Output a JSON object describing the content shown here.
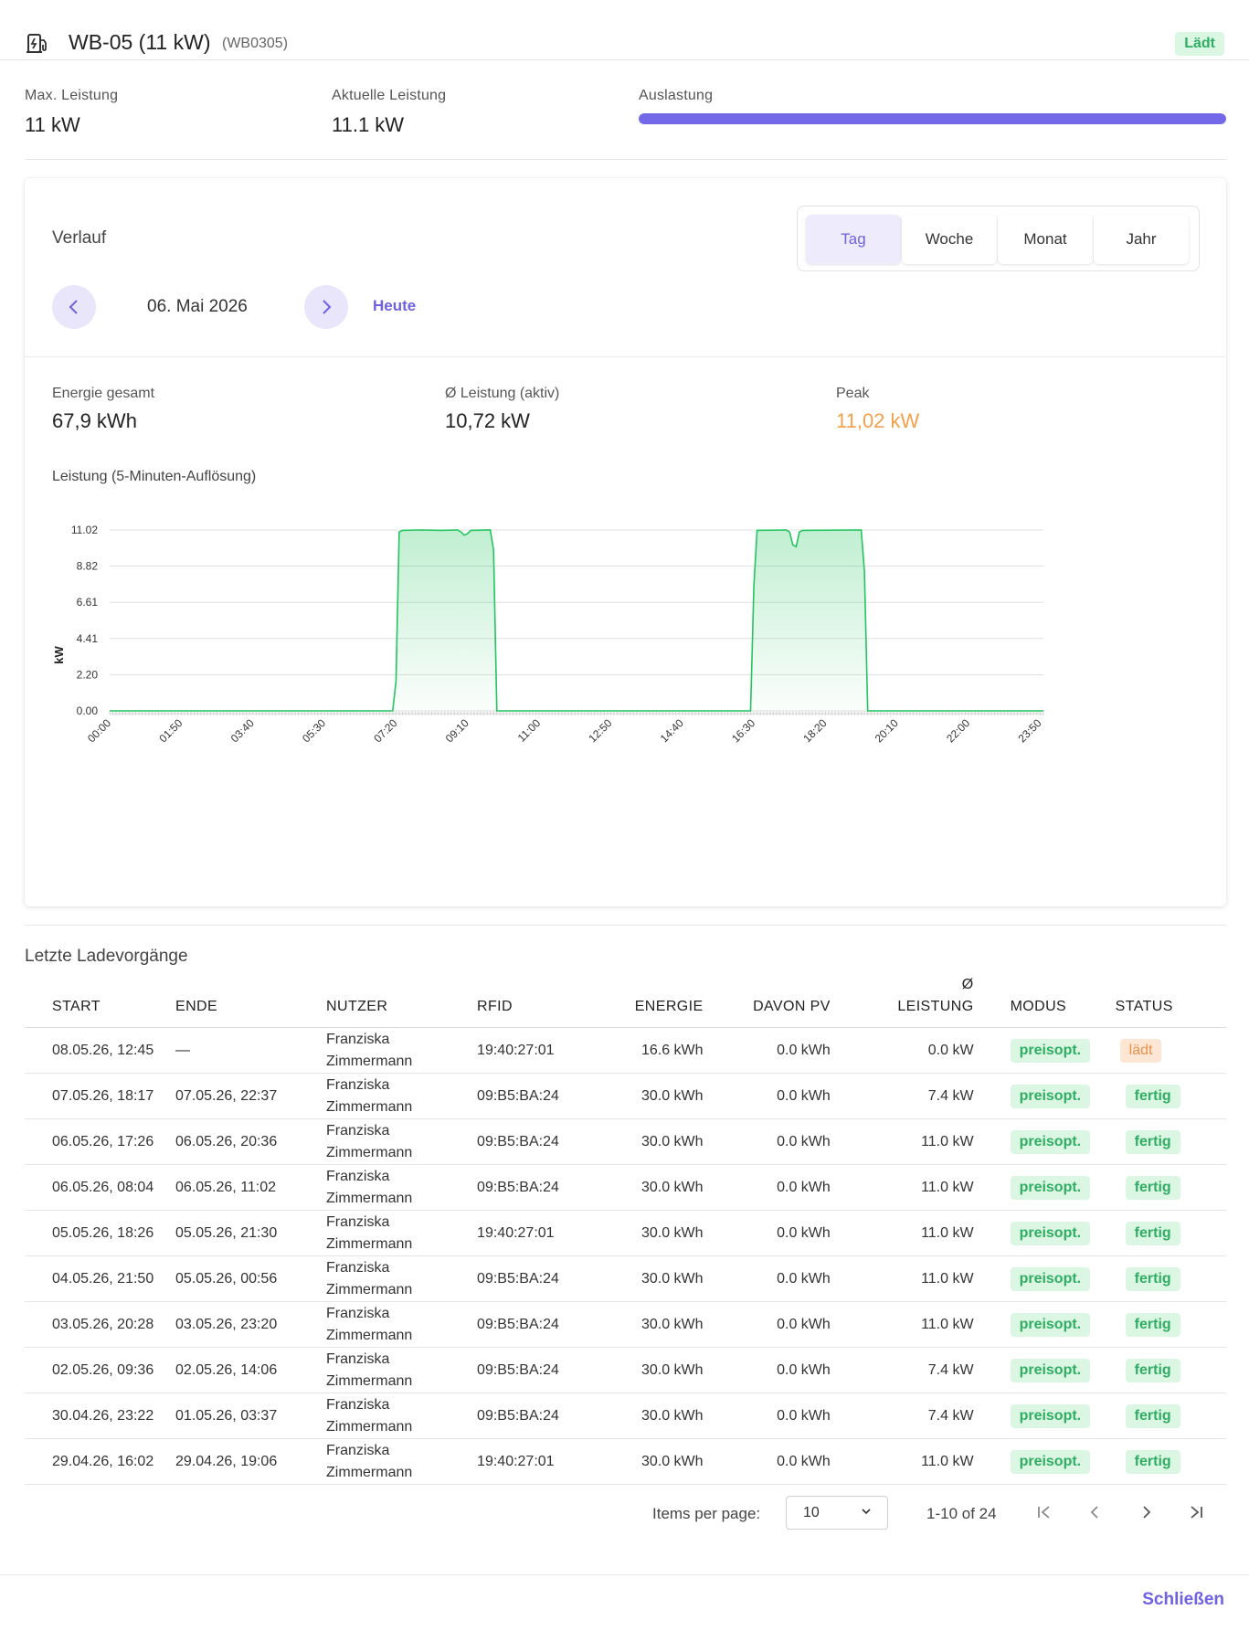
{
  "header": {
    "title": "WB-05 (11 kW)",
    "subtitle": "(WB0305)",
    "status": "Lädt"
  },
  "stats": {
    "max_label": "Max. Leistung",
    "max_value": "11 kW",
    "current_label": "Aktuelle Leistung",
    "current_value": "11.1 kW",
    "util_label": "Auslastung",
    "util_fraction": 1.0,
    "util_color": "#7268e8"
  },
  "history": {
    "title": "Verlauf",
    "tabs": [
      {
        "label": "Tag",
        "active": true
      },
      {
        "label": "Woche",
        "active": false
      },
      {
        "label": "Monat",
        "active": false
      },
      {
        "label": "Jahr",
        "active": false
      }
    ],
    "date": "06. Mai 2026",
    "today_link": "Heute",
    "prev_icon": "chevron-left-icon",
    "next_icon": "chevron-right-icon",
    "kpis": {
      "energy_label": "Energie gesamt",
      "energy_value": "67,9 kWh",
      "avg_label": "Ø Leistung (aktiv)",
      "avg_value": "10,72 kW",
      "peak_label": "Peak",
      "peak_value": "11,02 kW",
      "peak_color": "#f5a04a"
    },
    "chart_title": "Leistung (5-Minuten-Auflösung)"
  },
  "chart_data": {
    "type": "area",
    "title": "Leistung (5-Minuten-Auflösung)",
    "xlabel": "",
    "ylabel": "kW",
    "x_ticks": [
      "00:00",
      "01:50",
      "03:40",
      "05:30",
      "07:20",
      "09:10",
      "11:00",
      "12:50",
      "14:40",
      "16:30",
      "18:20",
      "20:10",
      "22:00",
      "23:50"
    ],
    "y_ticks": [
      "0.00",
      "2.20",
      "4.41",
      "6.61",
      "8.82",
      "11.02"
    ],
    "ylim": [
      0,
      11.02
    ],
    "xlim_minutes": [
      0,
      1435
    ],
    "grid": true,
    "legend": "none",
    "color": "#22c55e",
    "series": [
      {
        "points": [
          [
            "00:00",
            0
          ],
          [
            "07:15",
            0
          ],
          [
            "07:20",
            1.8
          ],
          [
            "07:25",
            10.9
          ],
          [
            "07:30",
            11.0
          ],
          [
            "08:00",
            11.02
          ],
          [
            "08:30",
            11.0
          ],
          [
            "08:55",
            11.02
          ],
          [
            "09:00",
            10.9
          ],
          [
            "09:05",
            10.7
          ],
          [
            "09:10",
            10.8
          ],
          [
            "09:15",
            11.0
          ],
          [
            "09:45",
            11.02
          ],
          [
            "09:50",
            9.8
          ],
          [
            "09:55",
            0
          ],
          [
            "16:25",
            0
          ],
          [
            "16:30",
            7.6
          ],
          [
            "16:35",
            11.0
          ],
          [
            "17:20",
            11.02
          ],
          [
            "17:25",
            10.9
          ],
          [
            "17:30",
            10.1
          ],
          [
            "17:35",
            10.0
          ],
          [
            "17:40",
            10.9
          ],
          [
            "17:45",
            11.0
          ],
          [
            "19:15",
            11.02
          ],
          [
            "19:20",
            8.5
          ],
          [
            "19:25",
            0
          ],
          [
            "23:55",
            0
          ]
        ]
      }
    ]
  },
  "recent": {
    "title": "Letzte Ladevorgänge",
    "columns": [
      "START",
      "ENDE",
      "NUTZER",
      "RFID",
      "ENERGIE",
      "DAVON PV",
      "Ø LEISTUNG",
      "MODUS",
      "STATUS"
    ],
    "rows": [
      {
        "start": "08.05.26, 12:45",
        "ende": "—",
        "nutzer": "Franziska Zimmermann",
        "rfid": "19:40:27:01",
        "energie": "16.6 kWh",
        "pv": "0.0 kWh",
        "leistung": "0.0 kW",
        "modus": "preisopt.",
        "status": "lädt",
        "status_color": "orange"
      },
      {
        "start": "07.05.26, 18:17",
        "ende": "07.05.26, 22:37",
        "nutzer": "Franziska Zimmermann",
        "rfid": "09:B5:BA:24",
        "energie": "30.0 kWh",
        "pv": "0.0 kWh",
        "leistung": "7.4 kW",
        "modus": "preisopt.",
        "status": "fertig",
        "status_color": "green"
      },
      {
        "start": "06.05.26, 17:26",
        "ende": "06.05.26, 20:36",
        "nutzer": "Franziska Zimmermann",
        "rfid": "09:B5:BA:24",
        "energie": "30.0 kWh",
        "pv": "0.0 kWh",
        "leistung": "11.0 kW",
        "modus": "preisopt.",
        "status": "fertig",
        "status_color": "green"
      },
      {
        "start": "06.05.26, 08:04",
        "ende": "06.05.26, 11:02",
        "nutzer": "Franziska Zimmermann",
        "rfid": "09:B5:BA:24",
        "energie": "30.0 kWh",
        "pv": "0.0 kWh",
        "leistung": "11.0 kW",
        "modus": "preisopt.",
        "status": "fertig",
        "status_color": "green"
      },
      {
        "start": "05.05.26, 18:26",
        "ende": "05.05.26, 21:30",
        "nutzer": "Franziska Zimmermann",
        "rfid": "19:40:27:01",
        "energie": "30.0 kWh",
        "pv": "0.0 kWh",
        "leistung": "11.0 kW",
        "modus": "preisopt.",
        "status": "fertig",
        "status_color": "green"
      },
      {
        "start": "04.05.26, 21:50",
        "ende": "05.05.26, 00:56",
        "nutzer": "Franziska Zimmermann",
        "rfid": "09:B5:BA:24",
        "energie": "30.0 kWh",
        "pv": "0.0 kWh",
        "leistung": "11.0 kW",
        "modus": "preisopt.",
        "status": "fertig",
        "status_color": "green"
      },
      {
        "start": "03.05.26, 20:28",
        "ende": "03.05.26, 23:20",
        "nutzer": "Franziska Zimmermann",
        "rfid": "09:B5:BA:24",
        "energie": "30.0 kWh",
        "pv": "0.0 kWh",
        "leistung": "11.0 kW",
        "modus": "preisopt.",
        "status": "fertig",
        "status_color": "green"
      },
      {
        "start": "02.05.26, 09:36",
        "ende": "02.05.26, 14:06",
        "nutzer": "Franziska Zimmermann",
        "rfid": "09:B5:BA:24",
        "energie": "30.0 kWh",
        "pv": "0.0 kWh",
        "leistung": "7.4 kW",
        "modus": "preisopt.",
        "status": "fertig",
        "status_color": "green"
      },
      {
        "start": "30.04.26, 23:22",
        "ende": "01.05.26, 03:37",
        "nutzer": "Franziska Zimmermann",
        "rfid": "09:B5:BA:24",
        "energie": "30.0 kWh",
        "pv": "0.0 kWh",
        "leistung": "7.4 kW",
        "modus": "preisopt.",
        "status": "fertig",
        "status_color": "green"
      },
      {
        "start": "29.04.26, 16:02",
        "ende": "29.04.26, 19:06",
        "nutzer": "Franziska Zimmermann",
        "rfid": "19:40:27:01",
        "energie": "30.0 kWh",
        "pv": "0.0 kWh",
        "leistung": "11.0 kW",
        "modus": "preisopt.",
        "status": "fertig",
        "status_color": "green"
      }
    ]
  },
  "pagination": {
    "items_per_page_label": "Items per page:",
    "items_per_page_value": "10",
    "range_label": "1-10 of 24"
  },
  "footer": {
    "close_label": "Schließen"
  }
}
